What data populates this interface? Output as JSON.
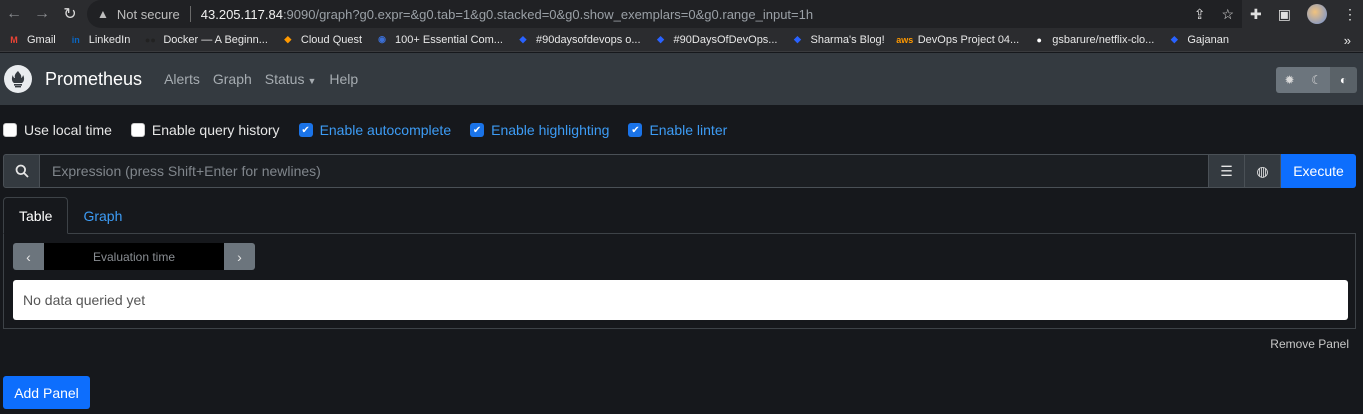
{
  "browser": {
    "security_text": "Not secure",
    "url_host": "43.205.117.84",
    "url_rest": ":9090/graph?g0.expr=&g0.tab=1&g0.stacked=0&g0.show_exemplars=0&g0.range_input=1h",
    "bookmarks": [
      {
        "label": "Gmail",
        "icon": "gmail-icon",
        "color": "#ea4335",
        "glyph": "M"
      },
      {
        "label": "LinkedIn",
        "icon": "linkedin-icon",
        "color": "#0a66c2",
        "glyph": "in"
      },
      {
        "label": "Docker — A Beginn...",
        "icon": "docker-icon",
        "color": "#222222",
        "glyph": "●●"
      },
      {
        "label": "Cloud Quest",
        "icon": "cloudquest-icon",
        "color": "#ff9900",
        "glyph": "◆"
      },
      {
        "label": "100+ Essential Com...",
        "icon": "globe-icon",
        "color": "#3b6fd6",
        "glyph": "◉"
      },
      {
        "label": "#90daysofdevops o...",
        "icon": "hashnode-icon",
        "color": "#2962ff",
        "glyph": "◆"
      },
      {
        "label": "#90DaysOfDevOps...",
        "icon": "hashnode-icon",
        "color": "#2962ff",
        "glyph": "◆"
      },
      {
        "label": "Sharma's Blog!",
        "icon": "hashnode-icon",
        "color": "#2962ff",
        "glyph": "◆"
      },
      {
        "label": "DevOps Project 04...",
        "icon": "aws-icon",
        "color": "#ff9900",
        "glyph": "aws"
      },
      {
        "label": "gsbarure/netflix-clo...",
        "icon": "github-icon",
        "color": "#ffffff",
        "glyph": "●"
      },
      {
        "label": "Gajanan",
        "icon": "hashnode-icon",
        "color": "#2962ff",
        "glyph": "◆"
      }
    ]
  },
  "navbar": {
    "brand": "Prometheus",
    "links": [
      "Alerts",
      "Graph",
      "Status",
      "Help"
    ]
  },
  "options": [
    {
      "label": "Use local time",
      "checked": false
    },
    {
      "label": "Enable query history",
      "checked": false
    },
    {
      "label": "Enable autocomplete",
      "checked": true
    },
    {
      "label": "Enable highlighting",
      "checked": true
    },
    {
      "label": "Enable linter",
      "checked": true
    }
  ],
  "expression": {
    "placeholder": "Expression (press Shift+Enter for newlines)",
    "execute_label": "Execute"
  },
  "panel": {
    "tabs": [
      "Table",
      "Graph"
    ],
    "eval_placeholder": "Evaluation time",
    "empty_text": "No data queried yet",
    "remove_label": "Remove Panel"
  },
  "add_panel_label": "Add Panel",
  "colors": {
    "accent": "#0d6efd",
    "navbar": "#343a40",
    "background": "#16181c"
  }
}
